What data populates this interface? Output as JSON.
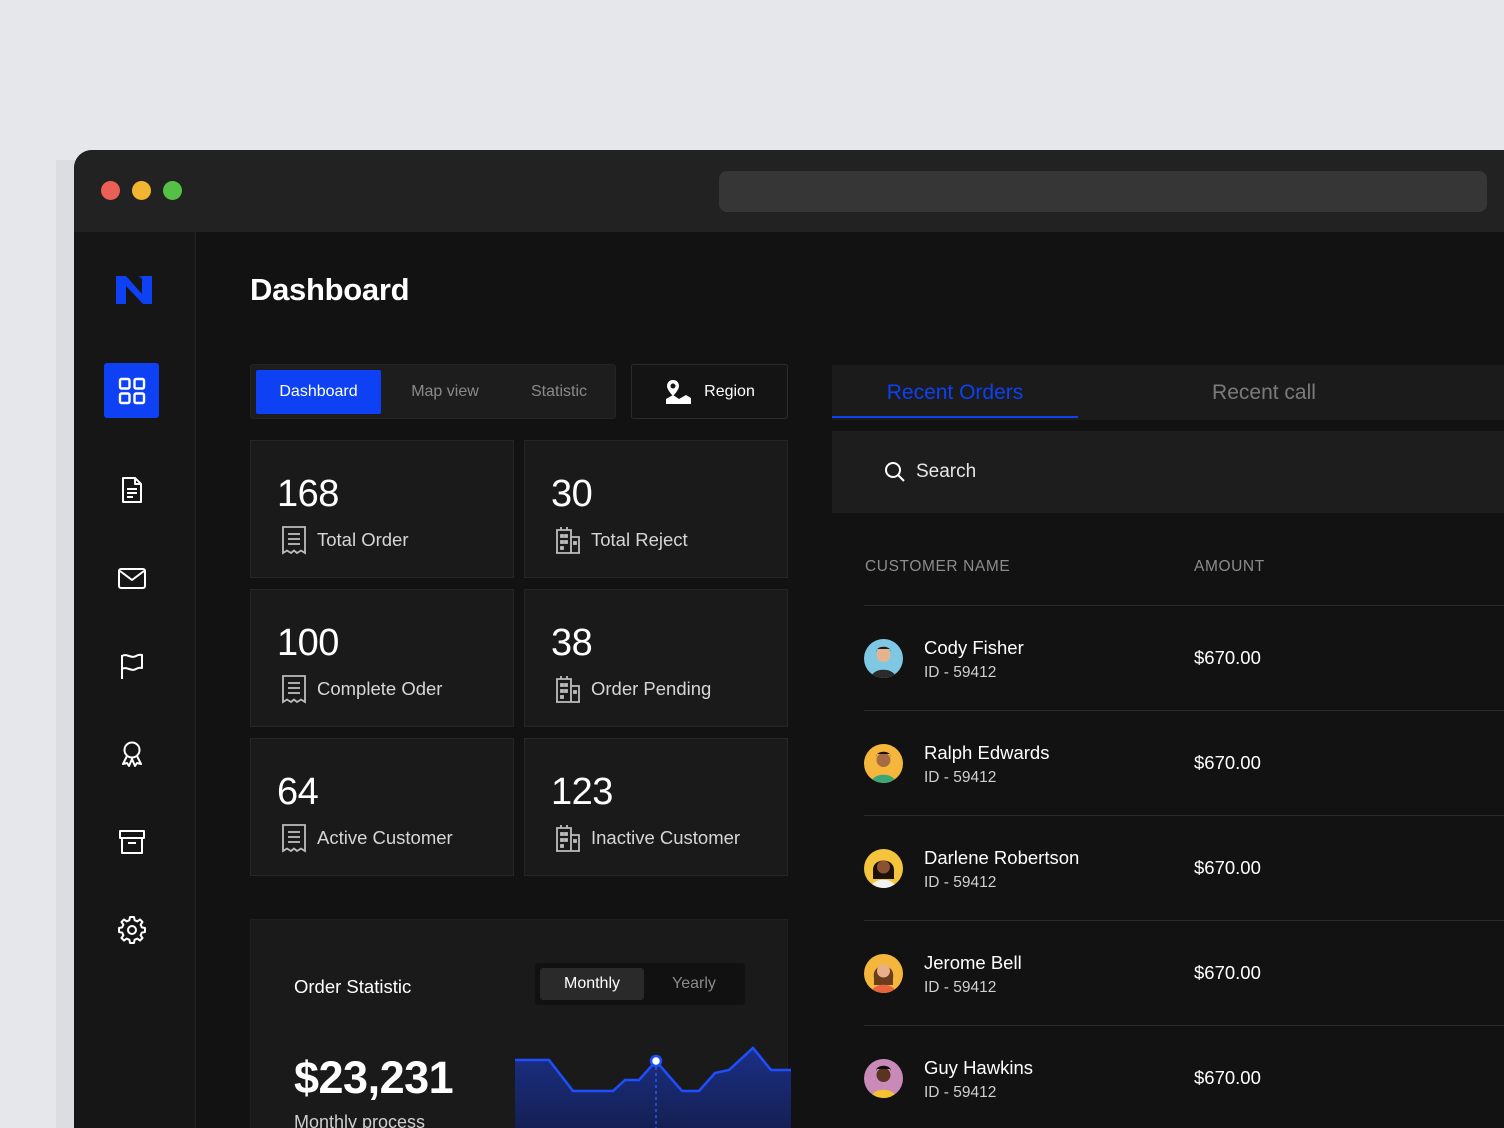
{
  "page": {
    "title": "Dashboard"
  },
  "tabs": [
    {
      "label": "Dashboard",
      "active": true
    },
    {
      "label": "Map view",
      "active": false
    },
    {
      "label": "Statistic",
      "active": false
    }
  ],
  "region_button": {
    "label": "Region",
    "icon": "map-pin-icon"
  },
  "sidebar": {
    "items": [
      {
        "icon": "grid-icon",
        "active": true
      },
      {
        "icon": "document-icon",
        "active": false
      },
      {
        "icon": "mail-icon",
        "active": false
      },
      {
        "icon": "flag-icon",
        "active": false
      },
      {
        "icon": "award-icon",
        "active": false
      },
      {
        "icon": "archive-icon",
        "active": false
      },
      {
        "icon": "gear-icon",
        "active": false
      }
    ]
  },
  "stats": [
    {
      "value": "168",
      "label": "Total Order",
      "icon": "receipt-icon"
    },
    {
      "value": "30",
      "label": "Total Reject",
      "icon": "building-icon"
    },
    {
      "value": "100",
      "label": "Complete Oder",
      "icon": "receipt-icon"
    },
    {
      "value": "38",
      "label": "Order Pending",
      "icon": "building-icon"
    },
    {
      "value": "64",
      "label": "Active Customer",
      "icon": "receipt-icon"
    },
    {
      "value": "123",
      "label": "Inactive Customer",
      "icon": "building-icon"
    }
  ],
  "order_statistic": {
    "title": "Order Statistic",
    "toggle": [
      {
        "label": "Monthly",
        "active": true
      },
      {
        "label": "Yearly",
        "active": false
      }
    ],
    "amount": "$23,231",
    "subtitle": "Monthly process"
  },
  "orders_panel": {
    "tabs": [
      {
        "label": "Recent Orders",
        "active": true
      },
      {
        "label": "Recent call",
        "active": false
      }
    ],
    "search": {
      "placeholder": "Search"
    },
    "columns": [
      "CUSTOMER NAME",
      "AMOUNT"
    ],
    "rows": [
      {
        "name": "Cody Fisher",
        "id": "ID - 59412",
        "amount": "$670.00",
        "avatar_color": "#7ec8e3"
      },
      {
        "name": "Ralph Edwards",
        "id": "ID - 59412",
        "amount": "$670.00",
        "avatar_color": "#f4b73c"
      },
      {
        "name": "Darlene Robertson",
        "id": "ID - 59412",
        "amount": "$670.00",
        "avatar_color": "#f4c43c"
      },
      {
        "name": "Jerome Bell",
        "id": "ID - 59412",
        "amount": "$670.00",
        "avatar_color": "#f4b73c"
      },
      {
        "name": "Guy Hawkins",
        "id": "ID - 59412",
        "amount": "$670.00",
        "avatar_color": "#c98ab8"
      }
    ]
  },
  "colors": {
    "accent": "#0d41f3",
    "background": "#121212",
    "card": "#1a1a1a",
    "sidebar": "#161616"
  }
}
